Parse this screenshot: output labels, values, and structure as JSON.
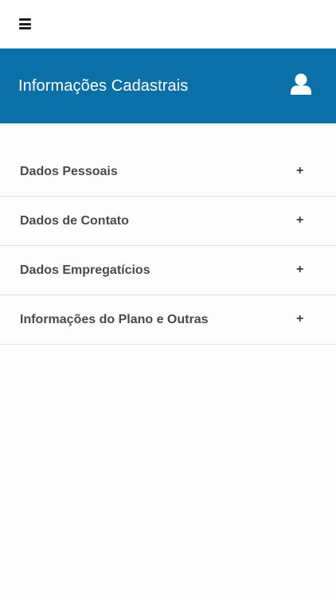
{
  "topbar": {
    "menu_icon": "hamburger-menu-icon"
  },
  "header": {
    "title": "Informações Cadastrais",
    "icon": "user-icon",
    "background": "#0c70a8"
  },
  "accordion": {
    "items": [
      {
        "label": "Dados Pessoais",
        "toggle": "+"
      },
      {
        "label": "Dados de Contato",
        "toggle": "+"
      },
      {
        "label": "Dados Empregatícios",
        "toggle": "+"
      },
      {
        "label": "Informações do Plano e Outras",
        "toggle": "+"
      }
    ]
  }
}
